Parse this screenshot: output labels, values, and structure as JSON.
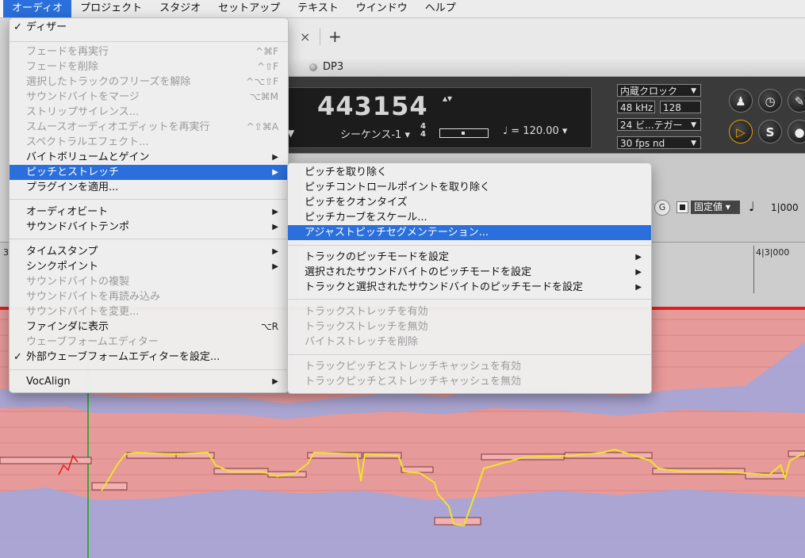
{
  "menubar": {
    "items": [
      "オーディオ",
      "プロジェクト",
      "スタジオ",
      "セットアップ",
      "テキスト",
      "ウインドウ",
      "ヘルプ"
    ]
  },
  "window": {
    "title": "DP3"
  },
  "transport": {
    "counter": "443154",
    "updown": "▴▾",
    "sequence": "シーケンス-1",
    "time_sig_top": "4",
    "time_sig_bottom": "4",
    "tempo": "120.00",
    "clock": "内蔵クロック",
    "sample_rate": "48 kHz",
    "buffer": "128",
    "bit_depth": "24 ビ...テガー",
    "frame_rate": "30 fps nd"
  },
  "toolbar": {
    "g_label": "G",
    "mode": "固定値",
    "value": "1|000"
  },
  "ruler": {
    "marker": "4|3|000",
    "left_marker": "3"
  },
  "audio_menu": {
    "items": [
      {
        "label": "ディザー",
        "checked": true
      },
      {
        "label": "フェードを再実行",
        "shortcut": "^⌘F",
        "disabled": true
      },
      {
        "label": "フェードを削除",
        "shortcut": "^⇧F",
        "disabled": true
      },
      {
        "label": "選択したトラックのフリーズを解除",
        "shortcut": "^⌥⇧F",
        "disabled": true
      },
      {
        "label": "サウンドバイトをマージ",
        "shortcut": "⌥⌘M",
        "disabled": true
      },
      {
        "label": "ストリップサイレンス...",
        "disabled": true
      },
      {
        "label": "スムースオーディオエディットを再実行",
        "shortcut": "^⇧⌘A",
        "disabled": true
      },
      {
        "label": "スペクトラルエフェクト...",
        "disabled": true
      },
      {
        "label": "バイトボリュームとゲイン",
        "submenu": true
      },
      {
        "label": "ピッチとストレッチ",
        "submenu": true,
        "selected": true
      },
      {
        "label": "プラグインを適用..."
      },
      {
        "label": "オーディオビート",
        "submenu": true
      },
      {
        "label": "サウンドバイトテンポ",
        "submenu": true
      },
      {
        "label": "タイムスタンプ",
        "submenu": true
      },
      {
        "label": "シンクポイント",
        "submenu": true
      },
      {
        "label": "サウンドバイトの複製",
        "disabled": true
      },
      {
        "label": "サウンドバイトを再読み込み",
        "disabled": true
      },
      {
        "label": "サウンドバイトを変更...",
        "disabled": true
      },
      {
        "label": "ファインダに表示",
        "shortcut": "⌥R"
      },
      {
        "label": "ウェーブフォームエディター",
        "disabled": true
      },
      {
        "label": "外部ウェーブフォームエディターを設定...",
        "checked": true
      },
      {
        "label": "VocAlign",
        "submenu": true
      }
    ]
  },
  "pitch_menu": {
    "items": [
      {
        "label": "ピッチを取り除く"
      },
      {
        "label": "ピッチコントロールポイントを取り除く"
      },
      {
        "label": "ピッチをクオンタイズ"
      },
      {
        "label": "ピッチカーブをスケール..."
      },
      {
        "label": "アジャストピッチセグメンテーション...",
        "selected": true
      },
      {
        "label": "トラックのピッチモードを設定",
        "submenu": true
      },
      {
        "label": "選択されたサウンドバイトのピッチモードを設定",
        "submenu": true
      },
      {
        "label": "トラックと選択されたサウンドバイトのピッチモードを設定",
        "submenu": true
      },
      {
        "label": "トラックストレッチを有効",
        "disabled": true
      },
      {
        "label": "トラックストレッチを無効",
        "disabled": true
      },
      {
        "label": "バイトストレッチを削除",
        "disabled": true
      },
      {
        "label": "トラックピッチとストレッチキャッシュを有効",
        "disabled": true
      },
      {
        "label": "トラックピッチとストレッチキャッシュを無効",
        "disabled": true
      }
    ]
  },
  "colors": {
    "accent": "#2a6fdb",
    "wave_red": "#e79a9a",
    "wave_blue": "#a3a6d8",
    "pitch_curve": "#f1e32a",
    "playhead": "#3aa63a"
  }
}
